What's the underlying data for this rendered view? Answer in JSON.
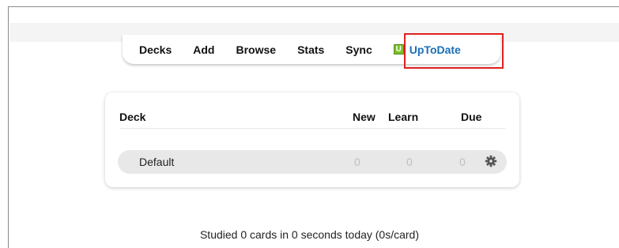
{
  "toolbar": {
    "items": [
      {
        "label": "Decks"
      },
      {
        "label": "Add"
      },
      {
        "label": "Browse"
      },
      {
        "label": "Stats"
      },
      {
        "label": "Sync"
      }
    ],
    "addon": {
      "label": "UpToDate",
      "icon": "uptodate-icon",
      "icon_letter": "U",
      "icon_color": "#7cbf2a"
    }
  },
  "deck_table": {
    "headers": {
      "deck": "Deck",
      "new": "New",
      "learn": "Learn",
      "due": "Due"
    },
    "rows": [
      {
        "name": "Default",
        "new": "0",
        "learn": "0",
        "due": "0",
        "options_icon": "gear-icon"
      }
    ]
  },
  "footer": {
    "studied": "Studied 0 cards in 0 seconds today (0s/card)"
  },
  "colors": {
    "highlight_border": "#e02020",
    "addon_text": "#1a6fb5",
    "row_bg": "#e8e8e8",
    "zero_count": "#bfbfbf"
  }
}
